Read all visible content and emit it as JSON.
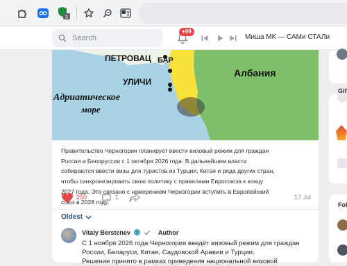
{
  "browser": {
    "extensions": [
      "puzzle-icon",
      "blue-extension-icon",
      "shield-extension-icon"
    ],
    "shield_badge": "3",
    "actions": [
      "star-icon",
      "zoom-icon",
      "translate-icon"
    ]
  },
  "header": {
    "search_placeholder": "Search",
    "notifications_badge": "+99",
    "now_playing": "Миша МК — САМи СТАЛи"
  },
  "post": {
    "map": {
      "labels": {
        "petrovac": "ПЕТРОВАЦ",
        "bar": "БАР",
        "ulcinj": "УЛИЧИ",
        "albania": "Албания",
        "sea_line1": "Адриатическое",
        "sea_line2": "море"
      }
    },
    "text_lines": [
      "Правительство Черногории планирует ввести визовый режим для граждан",
      "России и Белоруссии с 1 октября 2026 года. В дальнейшем власти",
      "собираются ввести визы для туристов из Турции, Китая и ряда других стран,",
      "чтобы синхронизировать свою политику с правилами Евросоюза к концу",
      "2027 года. Это связано с намерением Черногории вступить в Европейский",
      "союз в 2028 году."
    ],
    "likes": "250",
    "comments": "1",
    "date": "17 Jul"
  },
  "comments_section": {
    "sort_label": "Oldest",
    "comment": {
      "author": "Vitaly Berstenev",
      "tag": "Author",
      "lines": [
        "С 1 ноября 2026 года Черногория введёт визовый режим для граждан",
        "России, Беларуси, Китая, Саудовской Аравии и Турции.",
        "Решение принято в рамках приведения национальной визовой"
      ]
    }
  },
  "right_column": {
    "gifts_label": "Gift",
    "friends_label": "Fol"
  },
  "colors": {
    "accent_blue": "#2a5885",
    "like_red": "#e64646",
    "sea": "#a9d3e4",
    "land": "#7fbf6a",
    "coast": "#f6e23a"
  }
}
